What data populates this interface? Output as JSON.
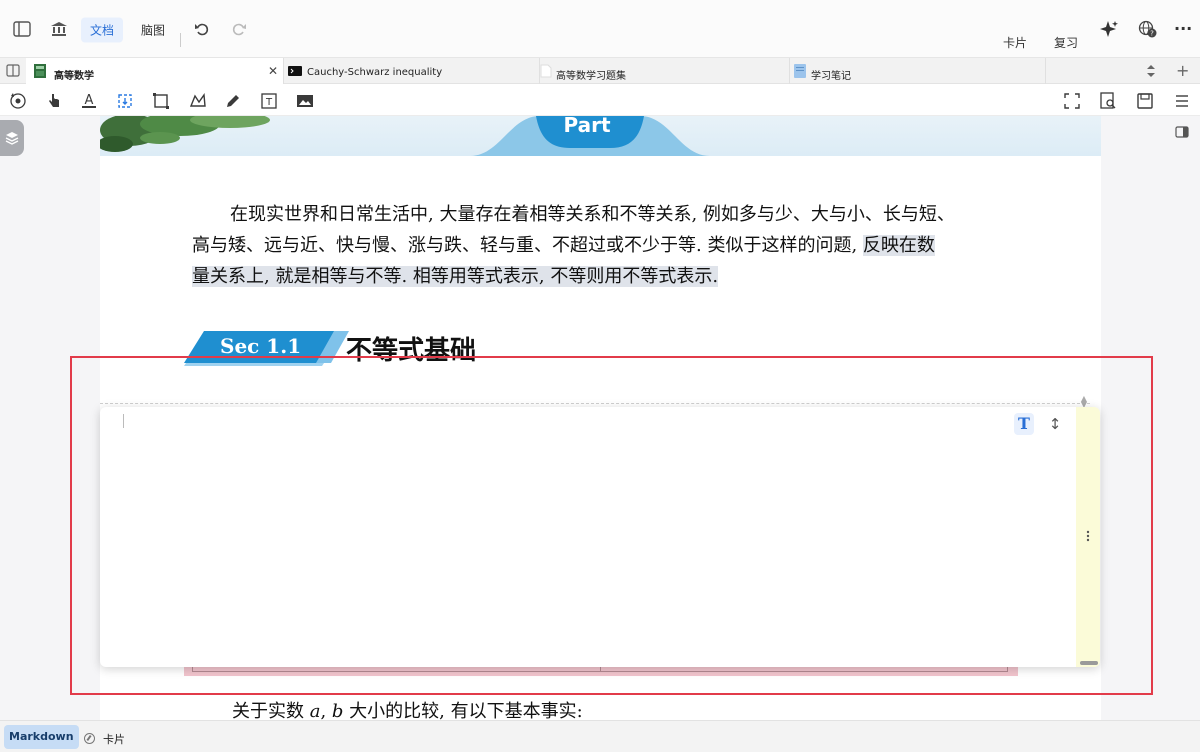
{
  "toolbar": {
    "doc_label": "文档",
    "mindmap_label": "脑图",
    "card_label": "卡片",
    "review_label": "复习",
    "more_label": "···"
  },
  "tabs": [
    {
      "label": "高等数学",
      "active": true,
      "icon": "green-book-icon"
    },
    {
      "label": "Cauchy-Schwarz inequality",
      "active": false,
      "icon": "terminal-icon"
    },
    {
      "label": "高等数学习题集",
      "active": false,
      "icon": "blank-doc-icon"
    },
    {
      "label": "学习笔记",
      "active": false,
      "icon": "blue-doc-icon"
    }
  ],
  "tabs_close": "✕",
  "tabs_add": "+",
  "document": {
    "banner_label": "Part",
    "para_line1": "在现实世界和日常生活中, 大量存在着相等关系和不等关系, 例如多与少、大与小、长与短、",
    "para_line2_a": "高与矮、远与近、快与慢、涨与跌、轻与重、不超过或不少于等. 类似于这样的问题, ",
    "para_line2_b": "反映在数",
    "para_line3": "量关系上, 就是相等与不等. 相等用等式表示, 不等则用不等式表示.",
    "section_number": "Sec 1.1",
    "section_title": "不等式基础",
    "bottom_a": "关于实数 ",
    "bottom_var_a": "a",
    "bottom_comma": ", ",
    "bottom_var_b": "b",
    "bottom_b": " 大小的比较, 有以下基本事实:"
  },
  "editor": {
    "text_button": "T",
    "resize_button": "↕"
  },
  "status": {
    "markdown_label": "Markdown",
    "card_label": "卡片"
  },
  "colors": {
    "accent": "#2a7ae2",
    "highlight_box": "#e23b4a",
    "section_blue": "#1f8fd0"
  }
}
